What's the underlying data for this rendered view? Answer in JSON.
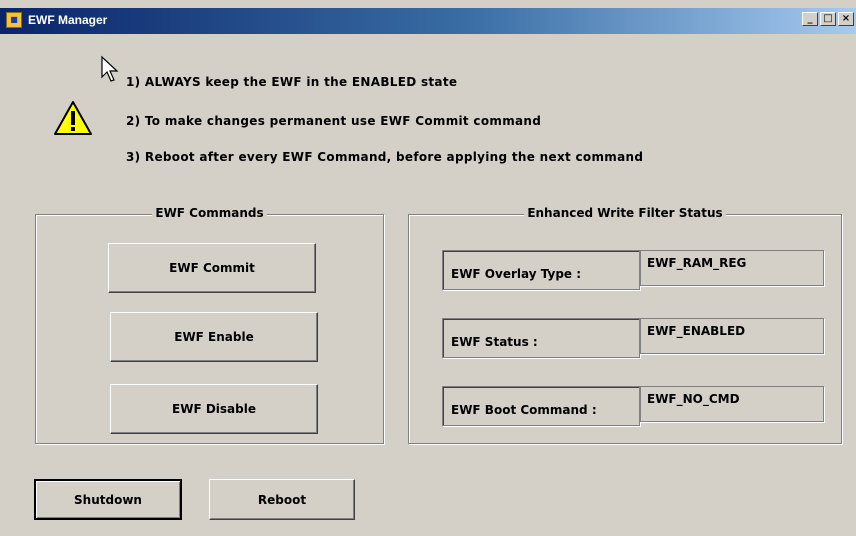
{
  "window": {
    "title": "EWF Manager"
  },
  "instructions": [
    "1)  ALWAYS keep the EWF in the ENABLED state",
    "2)  To make changes permanent use EWF Commit command",
    "3)  Reboot after every EWF Command, before applying the next command"
  ],
  "commands": {
    "legend": "EWF Commands",
    "commit_label": "EWF Commit",
    "enable_label": "EWF Enable",
    "disable_label": "EWF Disable"
  },
  "status": {
    "legend": "Enhanced Write Filter Status",
    "overlay_type_label": "EWF Overlay Type :",
    "overlay_type_value": "EWF_RAM_REG",
    "status_label": "EWF Status :",
    "status_value": "EWF_ENABLED",
    "boot_command_label": "EWF Boot Command :",
    "boot_command_value": "EWF_NO_CMD"
  },
  "footer": {
    "shutdown_label": "Shutdown",
    "reboot_label": "Reboot"
  },
  "icons": {
    "app": "ewf-app-icon",
    "warning": "warning-icon",
    "cursor": "mouse-cursor-icon"
  }
}
